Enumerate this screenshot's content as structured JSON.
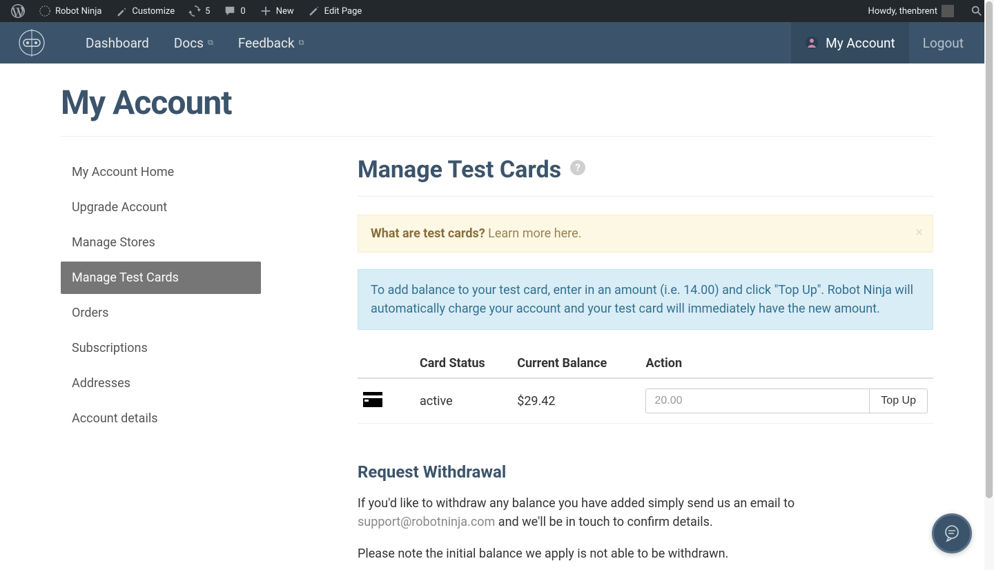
{
  "wp_bar": {
    "site_name": "Robot Ninja",
    "customize": "Customize",
    "updates": "5",
    "comments": "0",
    "new": "New",
    "edit": "Edit Page",
    "greeting": "Howdy, thenbrent"
  },
  "header": {
    "nav": {
      "dashboard": "Dashboard",
      "docs": "Docs",
      "feedback": "Feedback"
    },
    "my_account": "My Account",
    "logout": "Logout"
  },
  "page": {
    "title": "My Account"
  },
  "sidebar": {
    "items": [
      {
        "label": "My Account Home"
      },
      {
        "label": "Upgrade Account"
      },
      {
        "label": "Manage Stores"
      },
      {
        "label": "Manage Test Cards"
      },
      {
        "label": "Orders"
      },
      {
        "label": "Subscriptions"
      },
      {
        "label": "Addresses"
      },
      {
        "label": "Account details"
      }
    ]
  },
  "main": {
    "heading": "Manage Test Cards",
    "alert_warning": {
      "strong": "What are test cards?",
      "link": "Learn more here."
    },
    "alert_info": "To add balance to your test card, enter in an amount (i.e. 14.00) and click \"Top Up\". Robot Ninja will automatically charge your account and your test card will immediately have the new amount.",
    "table": {
      "headers": {
        "status": "Card Status",
        "balance": "Current Balance",
        "action": "Action"
      },
      "row": {
        "status": "active",
        "balance": "$29.42",
        "placeholder": "20.00",
        "button": "Top Up"
      }
    },
    "withdrawal": {
      "title": "Request Withdrawal",
      "text_before": "If you'd like to withdraw any balance you have added simply send us an email to ",
      "email": "support@robotninja.com",
      "text_after": " and we'll be in touch to confirm details.",
      "note": "Please note the initial balance we apply is not able to be withdrawn."
    }
  }
}
